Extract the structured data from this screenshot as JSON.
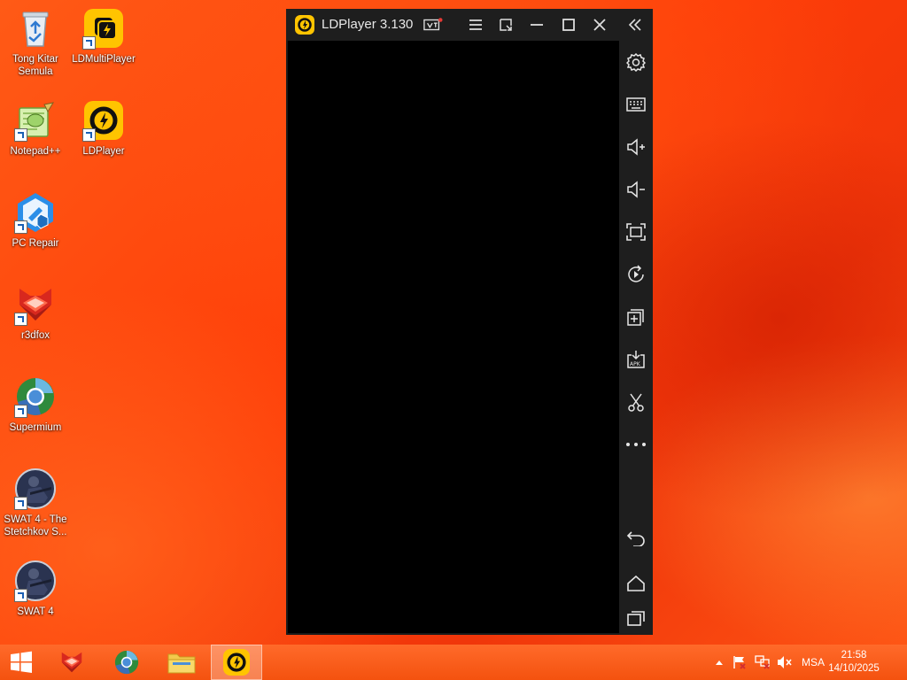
{
  "desktop": {
    "icons": [
      {
        "label": "Tong Kitar Semula",
        "icon": "recycle-bin-icon"
      },
      {
        "label": "LDMultiPlayer",
        "icon": "ldmultiplayer-icon"
      },
      {
        "label": "Notepad++",
        "icon": "notepad-plus-plus-icon"
      },
      {
        "label": "LDPlayer",
        "icon": "ldplayer-icon"
      },
      {
        "label": "PC Repair",
        "icon": "pc-repair-icon"
      },
      {
        "label": "r3dfox",
        "icon": "r3dfox-icon"
      },
      {
        "label": "Supermium",
        "icon": "supermium-icon"
      },
      {
        "label": "SWAT 4 - The Stetchkov S...",
        "icon": "swat4-expansion-icon"
      },
      {
        "label": "SWAT 4",
        "icon": "swat4-icon"
      }
    ]
  },
  "ldplayer": {
    "title": "LDPlayer 3.130",
    "accent_color": "#ffc400",
    "titlebar_buttons": [
      "virtualization-icon",
      "menu-icon",
      "restore-size-icon",
      "minimize-icon",
      "maximize-icon",
      "close-icon",
      "collapse-sidebar-icon"
    ],
    "sidebar_buttons": [
      "settings-icon",
      "keyboard-icon",
      "volume-up-icon",
      "volume-down-icon",
      "fullscreen-icon",
      "rotate-icon",
      "multi-instance-icon",
      "install-apk-icon",
      "screenshot-cut-icon",
      "more-icon",
      "back-icon",
      "home-icon",
      "recent-apps-icon"
    ]
  },
  "taskbar": {
    "apps": [
      {
        "name": "start",
        "icon": "windows-logo-icon"
      },
      {
        "name": "r3dfox",
        "icon": "r3dfox-icon"
      },
      {
        "name": "supermium",
        "icon": "supermium-icon"
      },
      {
        "name": "file-explorer",
        "icon": "folder-icon"
      },
      {
        "name": "ldplayer",
        "icon": "ldplayer-icon"
      }
    ],
    "tray": {
      "language": "MSA",
      "time": "21:58",
      "date": "14/10/2025"
    }
  }
}
